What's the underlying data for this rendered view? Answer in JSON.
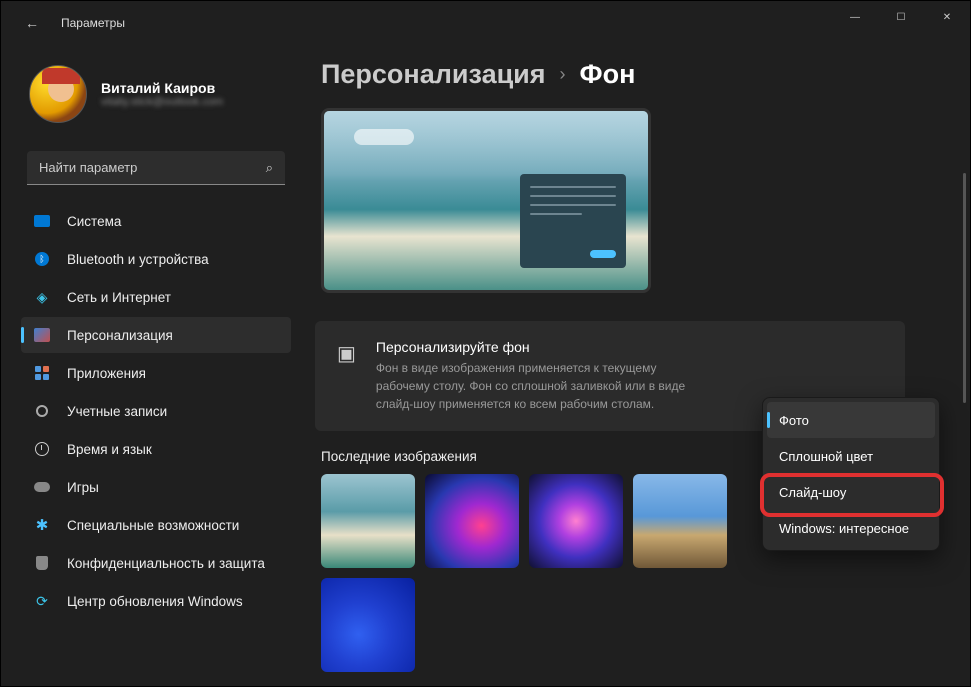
{
  "window": {
    "title": "Параметры"
  },
  "profile": {
    "name": "Виталий Каиров",
    "email": "vitaliy.stick@outlook.com"
  },
  "search": {
    "placeholder": "Найти параметр"
  },
  "nav": {
    "system": "Система",
    "bluetooth": "Bluetooth и устройства",
    "network": "Сеть и Интернет",
    "personalization": "Персонализация",
    "apps": "Приложения",
    "accounts": "Учетные записи",
    "time": "Время и язык",
    "gaming": "Игры",
    "accessibility": "Специальные возможности",
    "privacy": "Конфиденциальность и защита",
    "update": "Центр обновления Windows"
  },
  "breadcrumb": {
    "parent": "Персонализация",
    "current": "Фон"
  },
  "setting": {
    "title": "Персонализируйте фон",
    "desc": "Фон в виде изображения применяется к текущему рабочему столу. Фон со сплошной заливкой или в виде слайд-шоу применяется ко всем рабочим столам."
  },
  "recent_label": "Последние изображения",
  "dropdown": {
    "photo": "Фото",
    "solid": "Сплошной цвет",
    "slideshow": "Слайд-шоу",
    "spotlight": "Windows: интересное"
  }
}
